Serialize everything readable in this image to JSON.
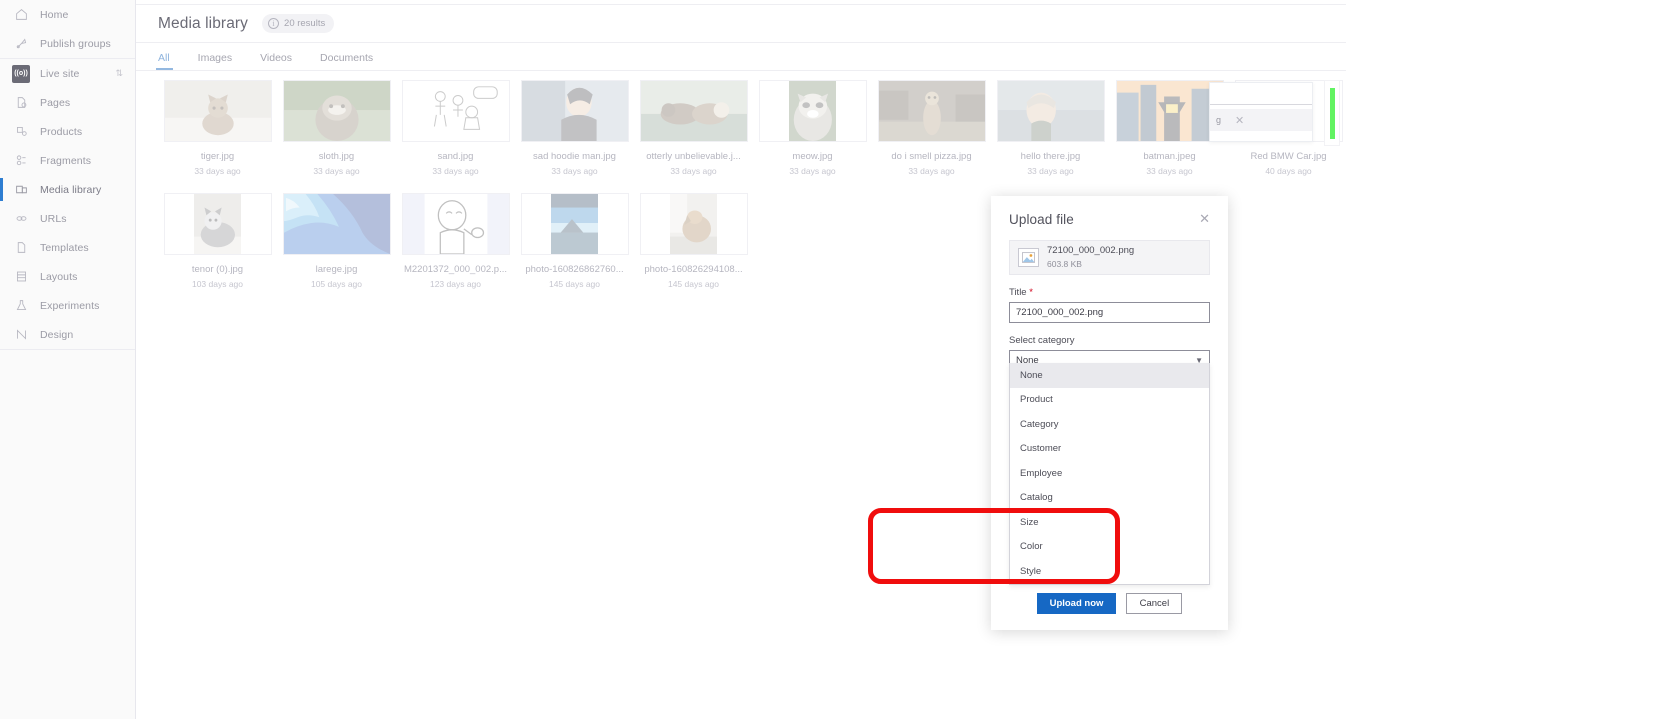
{
  "sidebar": {
    "groups": [
      {
        "items": [
          {
            "label": "Home",
            "icon": "home-icon",
            "active": false
          },
          {
            "label": "Publish groups",
            "icon": "publish-groups-icon",
            "active": false
          }
        ]
      },
      {
        "items": [
          {
            "label": "Live site",
            "icon": "live-site-icon",
            "active": false,
            "chevron": "⇅"
          },
          {
            "label": "Pages",
            "icon": "pages-icon",
            "active": false
          },
          {
            "label": "Products",
            "icon": "products-icon",
            "active": false
          },
          {
            "label": "Fragments",
            "icon": "fragments-icon",
            "active": false
          },
          {
            "label": "Media library",
            "icon": "media-library-icon",
            "active": true
          },
          {
            "label": "URLs",
            "icon": "urls-icon",
            "active": false
          },
          {
            "label": "Templates",
            "icon": "templates-icon",
            "active": false
          },
          {
            "label": "Layouts",
            "icon": "layouts-icon",
            "active": false
          },
          {
            "label": "Experiments",
            "icon": "experiments-icon",
            "active": false
          },
          {
            "label": "Design",
            "icon": "design-icon",
            "active": false
          }
        ]
      }
    ]
  },
  "header": {
    "title": "Media library",
    "results_chip": {
      "icon": "info-icon",
      "label": "20 results"
    },
    "tabs": [
      {
        "label": "All",
        "active": true
      },
      {
        "label": "Images",
        "active": false
      },
      {
        "label": "Videos",
        "active": false
      },
      {
        "label": "Documents",
        "active": false
      }
    ]
  },
  "grid": {
    "rows": [
      [
        {
          "name": "tiger.jpg",
          "date": "33 days ago",
          "thumb": "cat",
          "shape": "wide"
        },
        {
          "name": "sloth.jpg",
          "date": "33 days ago",
          "thumb": "sloth",
          "shape": "wide"
        },
        {
          "name": "sand.jpg",
          "date": "33 days ago",
          "thumb": "sketch",
          "shape": "wide"
        },
        {
          "name": "sad hoodie man.jpg",
          "date": "33 days ago",
          "thumb": "hoodie",
          "shape": "wide"
        },
        {
          "name": "otterly unbelievable.j...",
          "date": "33 days ago",
          "thumb": "otters",
          "shape": "wide"
        },
        {
          "name": "meow.jpg",
          "date": "33 days ago",
          "thumb": "raccoon",
          "shape": "narrow"
        },
        {
          "name": "do i smell pizza.jpg",
          "date": "33 days ago",
          "thumb": "meerkat",
          "shape": "wide"
        },
        {
          "name": "hello there.jpg",
          "date": "33 days ago",
          "thumb": "hello",
          "shape": "wide"
        },
        {
          "name": "batman.jpeg",
          "date": "33 days ago",
          "thumb": "batman",
          "shape": "wide"
        },
        {
          "name": "Red BMW Car.jpg",
          "date": "40 days ago",
          "thumb": "blank",
          "shape": "wide"
        }
      ],
      [
        {
          "name": "tenor (0).jpg",
          "date": "103 days ago",
          "thumb": "husky",
          "shape": "narrow"
        },
        {
          "name": "larege.jpg",
          "date": "105 days ago",
          "thumb": "ocean",
          "shape": "wide"
        },
        {
          "name": "M2201372_000_002.p...",
          "date": "123 days ago",
          "thumb": "meme",
          "shape": "wide"
        },
        {
          "name": "photo-160826862760...",
          "date": "145 days ago",
          "thumb": "mountain",
          "shape": "narrow"
        },
        {
          "name": "photo-160826294108...",
          "date": "145 days ago",
          "thumb": "dog",
          "shape": "narrow"
        }
      ]
    ]
  },
  "upload_toast": {
    "filename": "g",
    "close_icon": "close-icon",
    "progress_color": "#62f362"
  },
  "modal": {
    "title": "Upload file",
    "close_icon": "close-icon",
    "file": {
      "icon": "image-file-icon",
      "name": "72100_000_002.png",
      "size": "603.8 KB"
    },
    "title_field": {
      "label": "Title",
      "required_marker": "*",
      "value": "72100_000_002.png",
      "placeholder": "Title"
    },
    "category_field": {
      "label": "Select category",
      "value": "None",
      "chevron_icon": "chevron-down-icon",
      "options": [
        {
          "label": "None",
          "selected": true
        },
        {
          "label": "Product",
          "selected": false
        },
        {
          "label": "Category",
          "selected": false
        },
        {
          "label": "Customer",
          "selected": false
        },
        {
          "label": "Employee",
          "selected": false
        },
        {
          "label": "Catalog",
          "selected": false
        },
        {
          "label": "Size",
          "selected": false
        },
        {
          "label": "Color",
          "selected": false
        },
        {
          "label": "Style",
          "selected": false
        }
      ]
    },
    "buttons": {
      "primary": "Upload now",
      "secondary": "Cancel"
    }
  },
  "annotation": {
    "color": "#f00d0d",
    "shape": "rounded-rectangle",
    "highlights": [
      "Size",
      "Color",
      "Style"
    ]
  }
}
